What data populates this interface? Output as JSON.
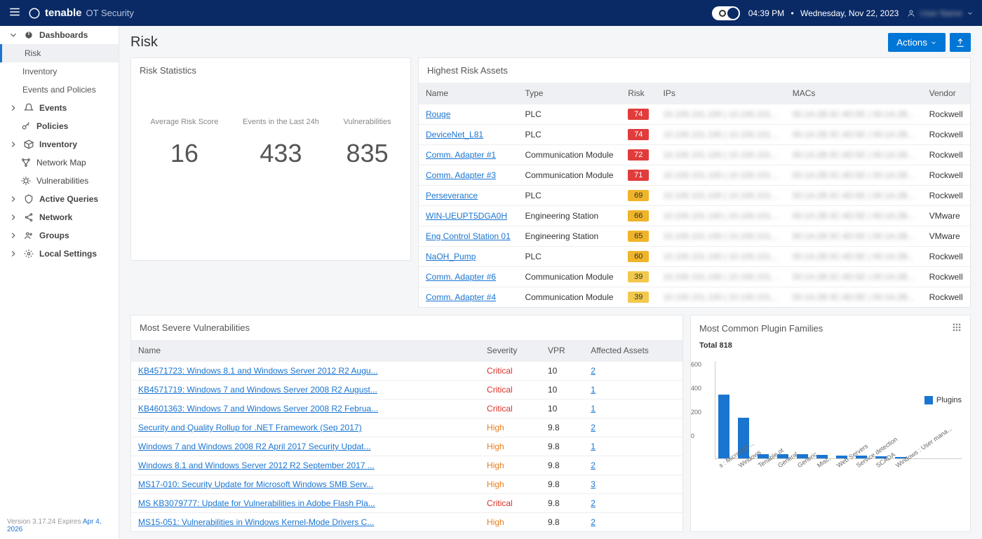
{
  "header": {
    "brand_name": "tenable",
    "brand_sub": "OT Security",
    "time": "04:39 PM",
    "sep": "•",
    "date": "Wednesday, Nov 22, 2023",
    "user": "—"
  },
  "sidebar": {
    "dashboards": "Dashboards",
    "risk": "Risk",
    "inventory_sub": "Inventory",
    "events_policies": "Events and Policies",
    "events": "Events",
    "policies": "Policies",
    "inventory": "Inventory",
    "network_map": "Network Map",
    "vulnerabilities": "Vulnerabilities",
    "active_queries": "Active Queries",
    "network": "Network",
    "groups": "Groups",
    "local_settings": "Local Settings",
    "version_prefix": "Version 3.17.24 Expires ",
    "version_date": "Apr 4, 2026"
  },
  "page": {
    "title": "Risk",
    "actions": "Actions"
  },
  "risk_stats": {
    "title": "Risk Statistics",
    "labels": [
      "Average Risk Score",
      "Events in the Last 24h",
      "Vulnerabilities"
    ],
    "values": [
      "16",
      "433",
      "835"
    ]
  },
  "assets": {
    "title": "Highest Risk Assets",
    "cols": [
      "Name",
      "Type",
      "Risk",
      "IPs",
      "MACs",
      "Vendor"
    ],
    "rows": [
      {
        "name": "Rouge",
        "type": "PLC",
        "risk": "74",
        "risk_class": "risk-red",
        "vendor": "Rockwell"
      },
      {
        "name": "DeviceNet_L81",
        "type": "PLC",
        "risk": "74",
        "risk_class": "risk-red",
        "vendor": "Rockwell"
      },
      {
        "name": "Comm. Adapter #1",
        "type": "Communication Module",
        "risk": "72",
        "risk_class": "risk-red",
        "vendor": "Rockwell"
      },
      {
        "name": "Comm. Adapter #3",
        "type": "Communication Module",
        "risk": "71",
        "risk_class": "risk-red",
        "vendor": "Rockwell"
      },
      {
        "name": "Perseverance",
        "type": "PLC",
        "risk": "69",
        "risk_class": "risk-amber",
        "vendor": "Rockwell"
      },
      {
        "name": "WIN-UEUPT5DGA0H",
        "type": "Engineering Station",
        "risk": "66",
        "risk_class": "risk-amber",
        "vendor": "VMware"
      },
      {
        "name": "Eng Control Station 01",
        "type": "Engineering Station",
        "risk": "65",
        "risk_class": "risk-amber",
        "vendor": "VMware"
      },
      {
        "name": "NaOH_Pump",
        "type": "PLC",
        "risk": "60",
        "risk_class": "risk-amber",
        "vendor": "Rockwell"
      },
      {
        "name": "Comm. Adapter #6",
        "type": "Communication Module",
        "risk": "39",
        "risk_class": "risk-amber2",
        "vendor": "Rockwell"
      },
      {
        "name": "Comm. Adapter #4",
        "type": "Communication Module",
        "risk": "39",
        "risk_class": "risk-amber2",
        "vendor": "Rockwell"
      }
    ]
  },
  "vulns": {
    "title": "Most Severe Vulnerabilities",
    "cols": [
      "Name",
      "Severity",
      "VPR",
      "Affected Assets"
    ],
    "rows": [
      {
        "name": "KB4571723: Windows 8.1 and Windows Server 2012 R2 Augu...",
        "sev": "Critical",
        "sev_class": "sev-critical",
        "vpr": "10",
        "assets": "2"
      },
      {
        "name": "KB4571719: Windows 7 and Windows Server 2008 R2 August...",
        "sev": "Critical",
        "sev_class": "sev-critical",
        "vpr": "10",
        "assets": "1"
      },
      {
        "name": "KB4601363: Windows 7 and Windows Server 2008 R2 Februa...",
        "sev": "Critical",
        "sev_class": "sev-critical",
        "vpr": "10",
        "assets": "1"
      },
      {
        "name": "Security and Quality Rollup for .NET Framework (Sep 2017)",
        "sev": "High",
        "sev_class": "sev-high",
        "vpr": "9.8",
        "assets": "2"
      },
      {
        "name": "Windows 7 and Windows 2008 R2 April 2017 Security Updat...",
        "sev": "High",
        "sev_class": "sev-high",
        "vpr": "9.8",
        "assets": "1"
      },
      {
        "name": "Windows 8.1 and Windows Server 2012 R2 September 2017 ...",
        "sev": "High",
        "sev_class": "sev-high",
        "vpr": "9.8",
        "assets": "2"
      },
      {
        "name": "MS17-010: Security Update for Microsoft Windows SMB Serv...",
        "sev": "High",
        "sev_class": "sev-high",
        "vpr": "9.8",
        "assets": "3"
      },
      {
        "name": "MS KB3079777: Update for Vulnerabilities in Adobe Flash Pla...",
        "sev": "Critical",
        "sev_class": "sev-critical",
        "vpr": "9.8",
        "assets": "2"
      },
      {
        "name": "MS15-051: Vulnerabilities in Windows Kernel-Mode Drivers C...",
        "sev": "High",
        "sev_class": "sev-high",
        "vpr": "9.8",
        "assets": "2"
      }
    ]
  },
  "plugins": {
    "title": "Most Common Plugin Families",
    "total_label": "Total 818",
    "legend": "Plugins"
  },
  "chart_data": {
    "type": "bar",
    "title": "Most Common Plugin Families",
    "categories": [
      "s : Microsoft ...",
      "Windows",
      "Tenable.ot",
      "General",
      "Generic",
      "Misc.",
      "Web Servers",
      "Service detection",
      "SCADA",
      "Windows : User mana..."
    ],
    "values": [
      420,
      270,
      30,
      28,
      26,
      22,
      20,
      18,
      12,
      8
    ],
    "ylabel": "",
    "xlabel": "",
    "ylim": [
      0,
      600
    ],
    "series_name": "Plugins",
    "total": 818
  }
}
